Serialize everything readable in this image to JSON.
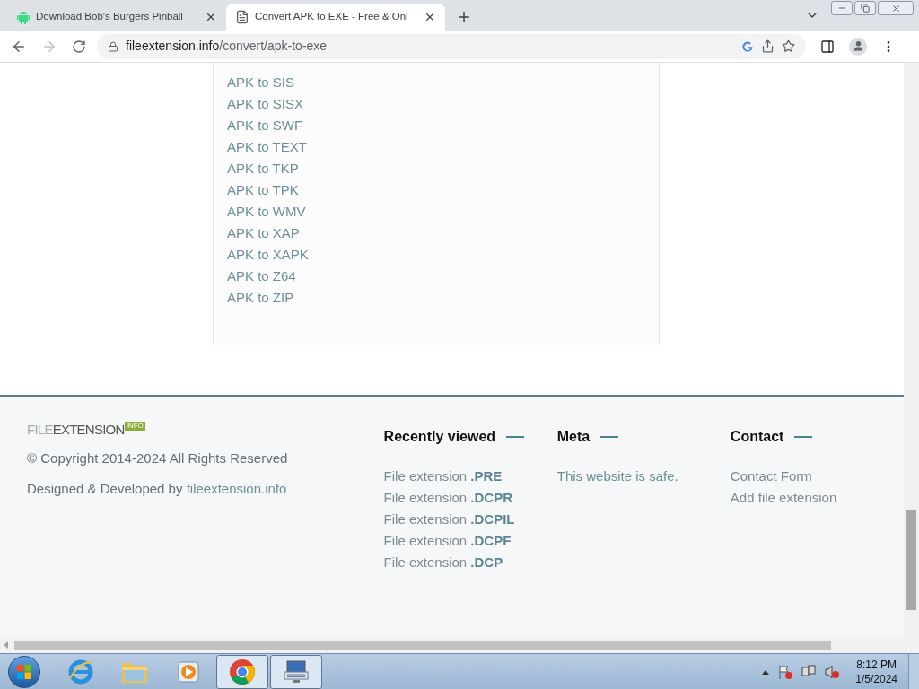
{
  "browser": {
    "tabs": [
      {
        "title": "Download Bob's Burgers Pinball",
        "kind": "android",
        "selected": false
      },
      {
        "title": "Convert APK to EXE - Free & Onl",
        "kind": "document",
        "selected": true
      }
    ],
    "address": {
      "domain": "fileextension.info",
      "path": "/convert/apk-to-exe"
    }
  },
  "conversions": [
    "APK to SIS",
    "APK to SISX",
    "APK to SWF",
    "APK to TEXT",
    "APK to TKP",
    "APK to TPK",
    "APK to WMV",
    "APK to XAP",
    "APK to XAPK",
    "APK to Z64",
    "APK to ZIP"
  ],
  "footer": {
    "logo": {
      "light": "FILE",
      "dark": "EXTENSION",
      "badge": "INFO"
    },
    "copyright": "© Copyright 2014-2024 All Rights Reserved",
    "designed": {
      "text": "Designed & Developed by",
      "link": "fileextension.info"
    },
    "columns": [
      {
        "heading": "Recently viewed",
        "kind": "extensions",
        "items": [
          {
            "text": "File extension",
            "ext": ".PRE"
          },
          {
            "text": "File extension",
            "ext": ".DCPR"
          },
          {
            "text": "File extension",
            "ext": ".DCPIL"
          },
          {
            "text": "File extension",
            "ext": ".DCPF"
          },
          {
            "text": "File extension",
            "ext": ".DCP"
          }
        ]
      },
      {
        "heading": "Meta",
        "kind": "text",
        "items": [
          {
            "text": "This website is safe."
          }
        ]
      },
      {
        "heading": "Contact",
        "kind": "links",
        "items": [
          {
            "text": "Contact Form"
          },
          {
            "text": "Add file extension"
          }
        ]
      }
    ]
  },
  "taskbar": {
    "apps": [
      {
        "kind": "ie",
        "running": false
      },
      {
        "kind": "explorer",
        "running": false
      },
      {
        "kind": "media",
        "running": false
      },
      {
        "kind": "chrome",
        "running": true
      },
      {
        "kind": "remote",
        "running": true
      }
    ],
    "clock": {
      "time": "8:12 PM",
      "date": "1/5/2024"
    }
  }
}
